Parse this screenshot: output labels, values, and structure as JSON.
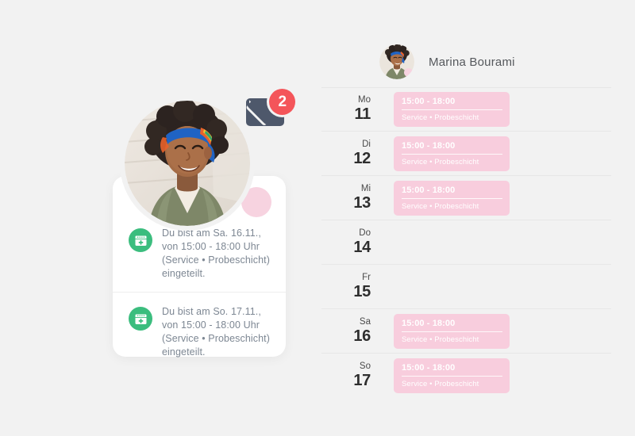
{
  "profile": {
    "name": "Marina Bourami",
    "avatar_icon": "user-avatar-photo"
  },
  "notifications": {
    "badge_count": "2",
    "envelope_icon": "envelope-icon",
    "items": [
      {
        "icon": "calendar-plus-icon",
        "text": "Du bist am Sa. 16.11., von 15:00 - 18:00 Uhr (Service • Probeschicht) eingeteilt."
      },
      {
        "icon": "calendar-plus-icon",
        "text": "Du bist am So. 17.11., von 15:00 - 18:00 Uhr (Service • Probeschicht) eingeteilt."
      }
    ]
  },
  "schedule": {
    "days": [
      {
        "abbr": "Mo",
        "date": "11",
        "shift": {
          "time": "15:00 - 18:00",
          "title": "Service • Probeschicht"
        }
      },
      {
        "abbr": "Di",
        "date": "12",
        "shift": {
          "time": "15:00 - 18:00",
          "title": "Service • Probeschicht"
        }
      },
      {
        "abbr": "Mi",
        "date": "13",
        "shift": {
          "time": "15:00 - 18:00",
          "title": "Service • Probeschicht"
        }
      },
      {
        "abbr": "Do",
        "date": "14",
        "shift": null
      },
      {
        "abbr": "Fr",
        "date": "15",
        "shift": null
      },
      {
        "abbr": "Sa",
        "date": "16",
        "shift": {
          "time": "15:00 - 18:00",
          "title": "Service • Probeschicht"
        }
      },
      {
        "abbr": "So",
        "date": "17",
        "shift": {
          "time": "15:00 - 18:00",
          "title": "Service • Probeschicht"
        }
      }
    ]
  },
  "colors": {
    "background": "#f2f2f2",
    "shift_block": "#f8cddd",
    "badge": "#f4555a",
    "envelope": "#4e586b",
    "note_icon": "#3bbd7e",
    "accent_dot": "#f7d3e0"
  }
}
